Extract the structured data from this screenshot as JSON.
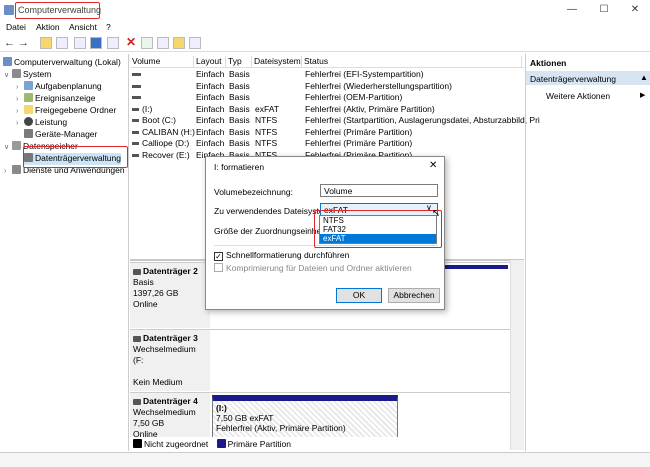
{
  "window": {
    "title": "Computerverwaltung",
    "minimize": "—",
    "maximize": "☐",
    "close": "✕"
  },
  "menu": {
    "items": [
      "Datei",
      "Aktion",
      "Ansicht",
      "?"
    ]
  },
  "tree": {
    "root": "Computerverwaltung (Lokal)",
    "system": "System",
    "items": [
      "Aufgabenplanung",
      "Ereignisanzeige",
      "Freigegebene Ordner",
      "Leistung",
      "Geräte-Manager"
    ],
    "storage": "Datenspeicher",
    "disk_mgmt": "Datenträgerverwaltung",
    "services": "Dienste und Anwendungen"
  },
  "table": {
    "headers": [
      "Volume",
      "Layout",
      "Typ",
      "Dateisystem",
      "Status"
    ],
    "rows": [
      {
        "volume": "",
        "layout": "Einfach",
        "typ": "Basis",
        "fs": "",
        "status": "Fehlerfrei (EFI-Systempartition)"
      },
      {
        "volume": "",
        "layout": "Einfach",
        "typ": "Basis",
        "fs": "",
        "status": "Fehlerfrei (Wiederherstellungspartition)"
      },
      {
        "volume": "",
        "layout": "Einfach",
        "typ": "Basis",
        "fs": "",
        "status": "Fehlerfrei (OEM-Partition)"
      },
      {
        "volume": "(I:)",
        "layout": "Einfach",
        "typ": "Basis",
        "fs": "exFAT",
        "status": "Fehlerfrei (Aktiv, Primäre Partition)"
      },
      {
        "volume": "Boot (C:)",
        "layout": "Einfach",
        "typ": "Basis",
        "fs": "NTFS",
        "status": "Fehlerfrei (Startpartition, Auslagerungsdatei, Absturzabbild, Pri"
      },
      {
        "volume": "CALIBAN (H:)",
        "layout": "Einfach",
        "typ": "Basis",
        "fs": "NTFS",
        "status": "Fehlerfrei (Primäre Partition)"
      },
      {
        "volume": "Calliope (D:)",
        "layout": "Einfach",
        "typ": "Basis",
        "fs": "NTFS",
        "status": "Fehlerfrei (Primäre Partition)"
      },
      {
        "volume": "Recover (E:)",
        "layout": "Einfach",
        "typ": "Basis",
        "fs": "NTFS",
        "status": "Fehlerfrei (Primäre Partition)"
      }
    ]
  },
  "actions": {
    "header": "Aktionen",
    "section": "Datenträgerverwaltung",
    "more": "Weitere Aktionen"
  },
  "disks": [
    {
      "name": "Datenträger 2",
      "type": "Basis",
      "size": "1397,26 GB",
      "state": "Online"
    },
    {
      "name": "Datenträger 3",
      "type": "Wechselmedium (F:",
      "size": "",
      "state": "Kein Medium"
    },
    {
      "name": "Datenträger 4",
      "type": "Wechselmedium",
      "size": "7,50 GB",
      "state": "Online",
      "part_name": "(I:)",
      "part_size": "7,50 GB exFAT",
      "part_status": "Fehlerfrei (Aktiv, Primäre Partition)"
    }
  ],
  "legend": {
    "unalloc": "Nicht zugeordnet",
    "primary": "Primäre Partition"
  },
  "dialog": {
    "title": "I: formatieren",
    "vol_label": "Volumebezeichnung:",
    "vol_value": "Volume",
    "fs_label": "Zu verwendendes Dateisystem:",
    "fs_value": "exFAT",
    "alloc_label": "Größe der Zuordnungseinheit:",
    "fs_options": [
      "NTFS",
      "FAT32",
      "exFAT"
    ],
    "quick": "Schnellformatierung durchführen",
    "compress": "Komprimierung für Dateien und Ordner aktivieren",
    "ok": "OK",
    "cancel": "Abbrechen"
  }
}
